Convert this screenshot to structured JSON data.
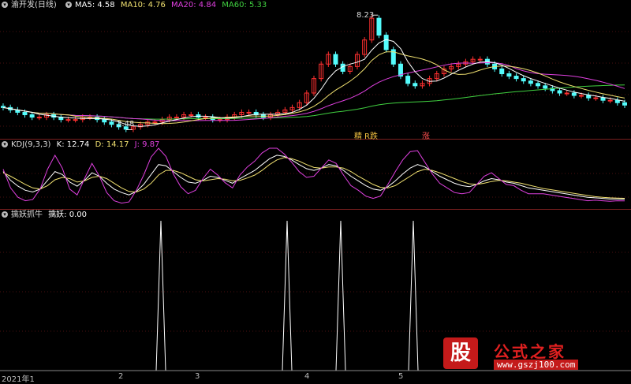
{
  "main_header": {
    "title": "渝开发(日线)",
    "ma5": "MA5: 4.58",
    "ma10": "MA10: 4.76",
    "ma20": "MA20: 4.84",
    "ma60": "MA60: 5.33"
  },
  "kdj_header": {
    "title": "KDJ(9,3,3)",
    "k": "K: 12.74",
    "d": "D: 14.17",
    "j": "J: 9.87"
  },
  "signal_header": {
    "title": "擒妖抓牛",
    "value": "擒妖: 0.00"
  },
  "annotations": {
    "high_price": "8.23",
    "low_price": "3.48",
    "label_1": "精",
    "label_2": "R跌",
    "label_3": "涨"
  },
  "x_axis_labels": [
    "2021年1",
    "2",
    "3",
    "4",
    "5"
  ],
  "watermark": {
    "gu": "股",
    "name": "公式之家",
    "url": "www.gszj100.com"
  },
  "colors": {
    "up": "#ff3030",
    "down": "#54fcfc",
    "ma5": "#ffffff",
    "ma10": "#f0e070",
    "ma20": "#e040e0",
    "ma60": "#40d040",
    "k_line": "#ffffff",
    "d_line": "#f0e070",
    "j_line": "#e040e0"
  },
  "chart_data": [
    {
      "type": "candlestick",
      "title": "渝开发(日线)",
      "note": "Approximate daily closes read from chart",
      "close": [
        4.4,
        4.3,
        4.2,
        4.1,
        4.0,
        4.0,
        4.1,
        4.0,
        3.9,
        3.9,
        3.9,
        4.0,
        4.0,
        3.9,
        3.8,
        3.7,
        3.6,
        3.5,
        3.6,
        3.7,
        3.8,
        3.8,
        3.9,
        4.0,
        4.0,
        4.1,
        4.1,
        4.0,
        4.0,
        3.9,
        3.9,
        4.0,
        4.1,
        4.2,
        4.2,
        4.1,
        4.0,
        4.1,
        4.2,
        4.3,
        4.4,
        4.6,
        5.0,
        5.6,
        6.2,
        6.6,
        6.2,
        5.9,
        6.1,
        6.6,
        7.2,
        8.1,
        7.4,
        6.8,
        6.2,
        5.7,
        5.4,
        5.3,
        5.4,
        5.6,
        5.8,
        6.0,
        6.1,
        6.2,
        6.3,
        6.4,
        6.4,
        6.2,
        6.0,
        5.8,
        5.7,
        5.6,
        5.5,
        5.4,
        5.3,
        5.2,
        5.1,
        5.0,
        5.0,
        4.9,
        4.9,
        4.8,
        4.8,
        4.7,
        4.7,
        4.6,
        4.5
      ],
      "high_marker": 8.23,
      "low_marker": 3.48,
      "ma_values_last": {
        "MA5": 4.58,
        "MA10": 4.76,
        "MA20": 4.84,
        "MA60": 5.33
      }
    },
    {
      "type": "line",
      "title": "KDJ(9,3,3)",
      "series": [
        {
          "name": "K",
          "values": [
            60,
            45,
            35,
            28,
            25,
            30,
            45,
            60,
            55,
            42,
            35,
            45,
            58,
            52,
            40,
            30,
            24,
            20,
            26,
            38,
            55,
            72,
            70,
            60,
            50,
            42,
            40,
            45,
            52,
            50,
            45,
            40,
            48,
            55,
            62,
            72,
            82,
            88,
            86,
            80,
            72,
            65,
            62,
            66,
            72,
            70,
            62,
            52,
            44,
            36,
            30,
            28,
            34,
            44,
            56,
            66,
            72,
            68,
            60,
            52,
            46,
            40,
            36,
            34,
            38,
            44,
            48,
            46,
            42,
            40,
            36,
            32,
            30,
            28,
            26,
            24,
            22,
            20,
            18,
            16,
            15,
            14,
            13,
            13,
            12.7
          ],
          "last": 12.74
        },
        {
          "name": "D",
          "values": [
            58,
            52,
            45,
            38,
            32,
            30,
            36,
            46,
            50,
            48,
            42,
            44,
            50,
            52,
            48,
            40,
            32,
            26,
            25,
            30,
            40,
            54,
            62,
            62,
            58,
            52,
            46,
            44,
            46,
            48,
            47,
            44,
            45,
            49,
            54,
            62,
            72,
            80,
            84,
            82,
            78,
            72,
            67,
            66,
            68,
            68,
            66,
            60,
            52,
            45,
            38,
            33,
            32,
            36,
            44,
            52,
            60,
            64,
            62,
            58,
            53,
            48,
            43,
            39,
            38,
            40,
            43,
            45,
            44,
            42,
            40,
            37,
            34,
            31,
            29,
            27,
            25,
            23,
            21,
            19,
            17,
            16,
            15,
            14.5,
            14.2
          ],
          "last": 14.17
        },
        {
          "name": "J",
          "values": [
            64,
            32,
            16,
            10,
            12,
            30,
            64,
            88,
            66,
            30,
            20,
            48,
            74,
            52,
            24,
            10,
            6,
            8,
            28,
            54,
            85,
            100,
            86,
            56,
            34,
            22,
            28,
            48,
            64,
            54,
            41,
            32,
            54,
            68,
            78,
            92,
            100,
            100,
            90,
            76,
            60,
            50,
            52,
            66,
            80,
            74,
            54,
            36,
            28,
            18,
            14,
            18,
            38,
            60,
            80,
            94,
            96,
            76,
            56,
            40,
            32,
            24,
            22,
            24,
            38,
            52,
            58,
            48,
            38,
            36,
            28,
            22,
            22,
            22,
            20,
            18,
            16,
            14,
            12,
            10,
            11,
            10,
            9,
            10,
            9.87
          ],
          "last": 9.87
        }
      ]
    },
    {
      "type": "line",
      "title": "擒妖抓牛",
      "series": [
        {
          "name": "擒妖",
          "spikes_at_x_fraction": [
            0.255,
            0.455,
            0.54,
            0.655
          ],
          "spike_value": 1,
          "last": 0.0
        }
      ]
    }
  ]
}
